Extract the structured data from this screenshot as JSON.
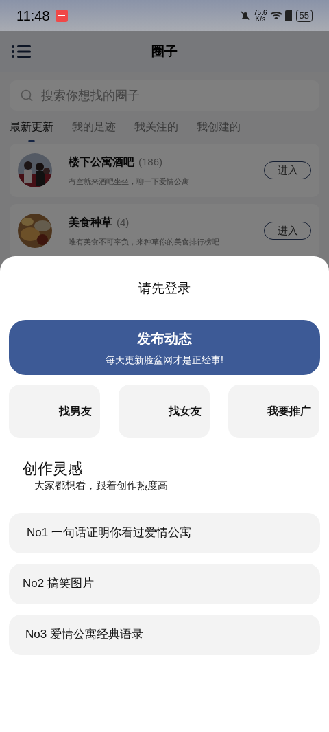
{
  "status_bar": {
    "time": "11:48",
    "net_speed": "75.6",
    "net_unit": "K/s",
    "battery": "55"
  },
  "header": {
    "title": "圈子"
  },
  "search": {
    "placeholder": "搜索你想找的圈子"
  },
  "tabs": [
    {
      "label": "最新更新",
      "selected": true
    },
    {
      "label": "我的足迹",
      "selected": false
    },
    {
      "label": "我关注的",
      "selected": false
    },
    {
      "label": "我创建的",
      "selected": false
    }
  ],
  "circles": [
    {
      "name": "楼下公寓酒吧",
      "count": "(186)",
      "description": "有空就来酒吧坐坐，聊一下爱情公寓",
      "button": "进入"
    },
    {
      "name": "美食种草",
      "count": "(4)",
      "description": "唯有美食不可辜负，来种草你的美食排行榜吧",
      "button": "进入"
    }
  ],
  "sheet": {
    "title": "请先登录",
    "publish": {
      "title": "发布动态",
      "subtitle": "每天更新脸盆网才是正经事!"
    },
    "shortcuts": [
      "找男友",
      "找女友",
      "我要推广"
    ],
    "section_title": "创作灵感",
    "section_subtitle": "大家都想看，跟着创作热度高",
    "ideas": [
      "No1 一句话证明你看过爱情公寓",
      "No2 搞笑图片",
      "No3 爱情公寓经典语录"
    ]
  }
}
